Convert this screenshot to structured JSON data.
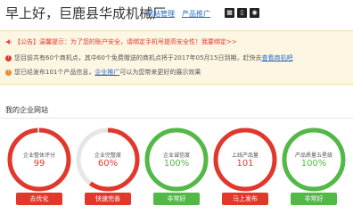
{
  "header": {
    "greeting": "早上好，巨鹿县华成机械厂",
    "links": [
      "网站管理",
      "产品推广"
    ],
    "icons": [
      "qr-icon",
      "mobile-icon",
      "weibo-icon"
    ]
  },
  "notice": {
    "tag": "【公告】",
    "tag_text": "温馨提示：为了您的账户安全，请绑定手机号提高安全性！",
    "tag_link": "我要绑定>>",
    "row2": {
      "pre": "您目前共有60个商机点，其中60个免费赠送的商机点将于2017年05月15日到期，赶快去",
      "link": "查看商机吧"
    },
    "row3": {
      "pre": "您已经发布101个产品信息，",
      "link": "企业推广",
      "post": "可以为您带来更好的展示效果"
    }
  },
  "section_title": "我的企业网站",
  "colors": {
    "red": "#e2382c",
    "green": "#52b846",
    "ring_bg": "#e6e6e6"
  },
  "cards": [
    {
      "label": "企业整体评分",
      "value": "99",
      "button": "去优化",
      "state": "red",
      "fraction": 0.99
    },
    {
      "label": "企业完整度",
      "value": "60%",
      "button": "快速完善",
      "state": "red",
      "fraction": 0.6
    },
    {
      "label": "企业诚信度",
      "value": "100%",
      "button": "非常好",
      "state": "green",
      "fraction": 1.0
    },
    {
      "label": "上线产品量",
      "value": "101",
      "button": "马上发布",
      "state": "red",
      "fraction": 1.0
    },
    {
      "label": "产品质量五星级",
      "value": "100%",
      "button": "非常好",
      "state": "green",
      "fraction": 1.0
    }
  ]
}
